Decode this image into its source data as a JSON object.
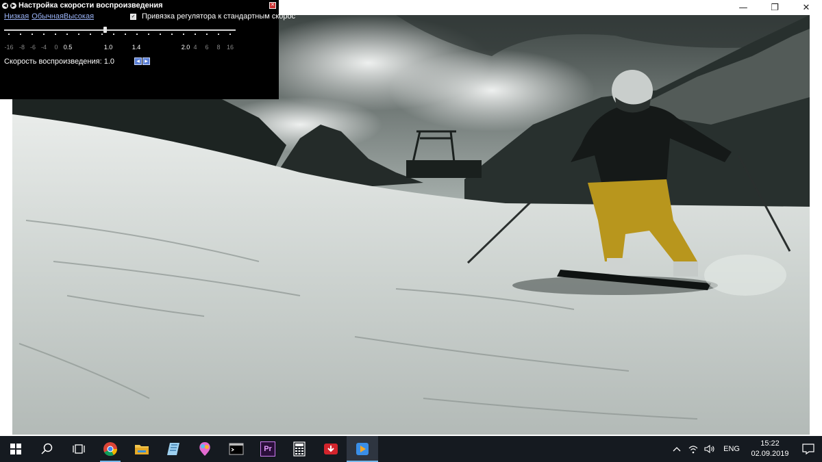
{
  "window": {
    "controls": {
      "minimize": "—",
      "restore": "❐",
      "close": "✕"
    }
  },
  "speed_panel": {
    "title": "Настройка скорости воспроизведения",
    "close_glyph": "✕",
    "presets": [
      "Низкая",
      "Обычная",
      "Высокая"
    ],
    "snap_label": "Привязка регулятора к стандартным скорос",
    "snap_checked": true,
    "slider_value": 1.0,
    "tick_labels": [
      "-16",
      "-8",
      "-6",
      "-4",
      "0",
      "0.5",
      "1.0",
      "1.4",
      "2.0",
      "4",
      "6",
      "8",
      "16"
    ],
    "speed_readout": "Скорость воспроизведения: 1.0",
    "step_buttons": [
      "◀",
      "▶"
    ]
  },
  "taskbar": {
    "apps": [
      {
        "name": "start",
        "icon": "windows-logo-icon"
      },
      {
        "name": "search",
        "icon": "search-icon"
      },
      {
        "name": "task-view",
        "icon": "task-view-icon"
      },
      {
        "name": "chrome",
        "icon": "chrome-icon"
      },
      {
        "name": "file-explorer",
        "icon": "folder-icon"
      },
      {
        "name": "notepad",
        "icon": "notebook-icon"
      },
      {
        "name": "paint",
        "icon": "paint-icon"
      },
      {
        "name": "terminal",
        "icon": "terminal-icon"
      },
      {
        "name": "premiere",
        "icon": "premiere-icon",
        "label": "Pr"
      },
      {
        "name": "calculator",
        "icon": "calculator-icon"
      },
      {
        "name": "downloader",
        "icon": "download-icon"
      },
      {
        "name": "media-player",
        "icon": "media-player-icon"
      }
    ],
    "tray": {
      "language": "ENG",
      "time": "15:22",
      "date": "02.09.2019"
    }
  },
  "colors": {
    "panel_bg": "#000000",
    "link": "#9bb4f7",
    "taskbar_bg": "#151a20",
    "taskbar_accent": "#76b9ed"
  }
}
